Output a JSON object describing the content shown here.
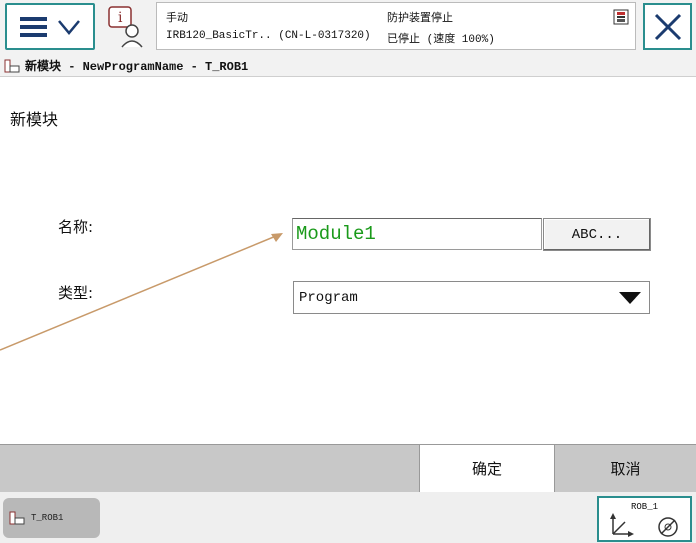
{
  "topbar": {
    "mode": "手动",
    "controller": "IRB120_BasicTr.. (CN-L-0317320)",
    "protection_status": "防护装置停止",
    "run_status": "已停止 (速度 100%)"
  },
  "titlebar": {
    "title": "新模块 - NewProgramName - T_ROB1"
  },
  "main": {
    "heading": "新模块",
    "name_label": "名称:",
    "name_value": "Module1",
    "abc_button": "ABC...",
    "type_label": "类型:",
    "type_value": "Program"
  },
  "buttons": {
    "ok": "确定",
    "cancel": "取消"
  },
  "taskbar": {
    "task_label": "T_ROB1",
    "robot_label": "ROB_1"
  },
  "colors": {
    "accent": "#2a8e8e",
    "value_text": "#1a9a1a",
    "annotation_line": "#c89a6a"
  }
}
